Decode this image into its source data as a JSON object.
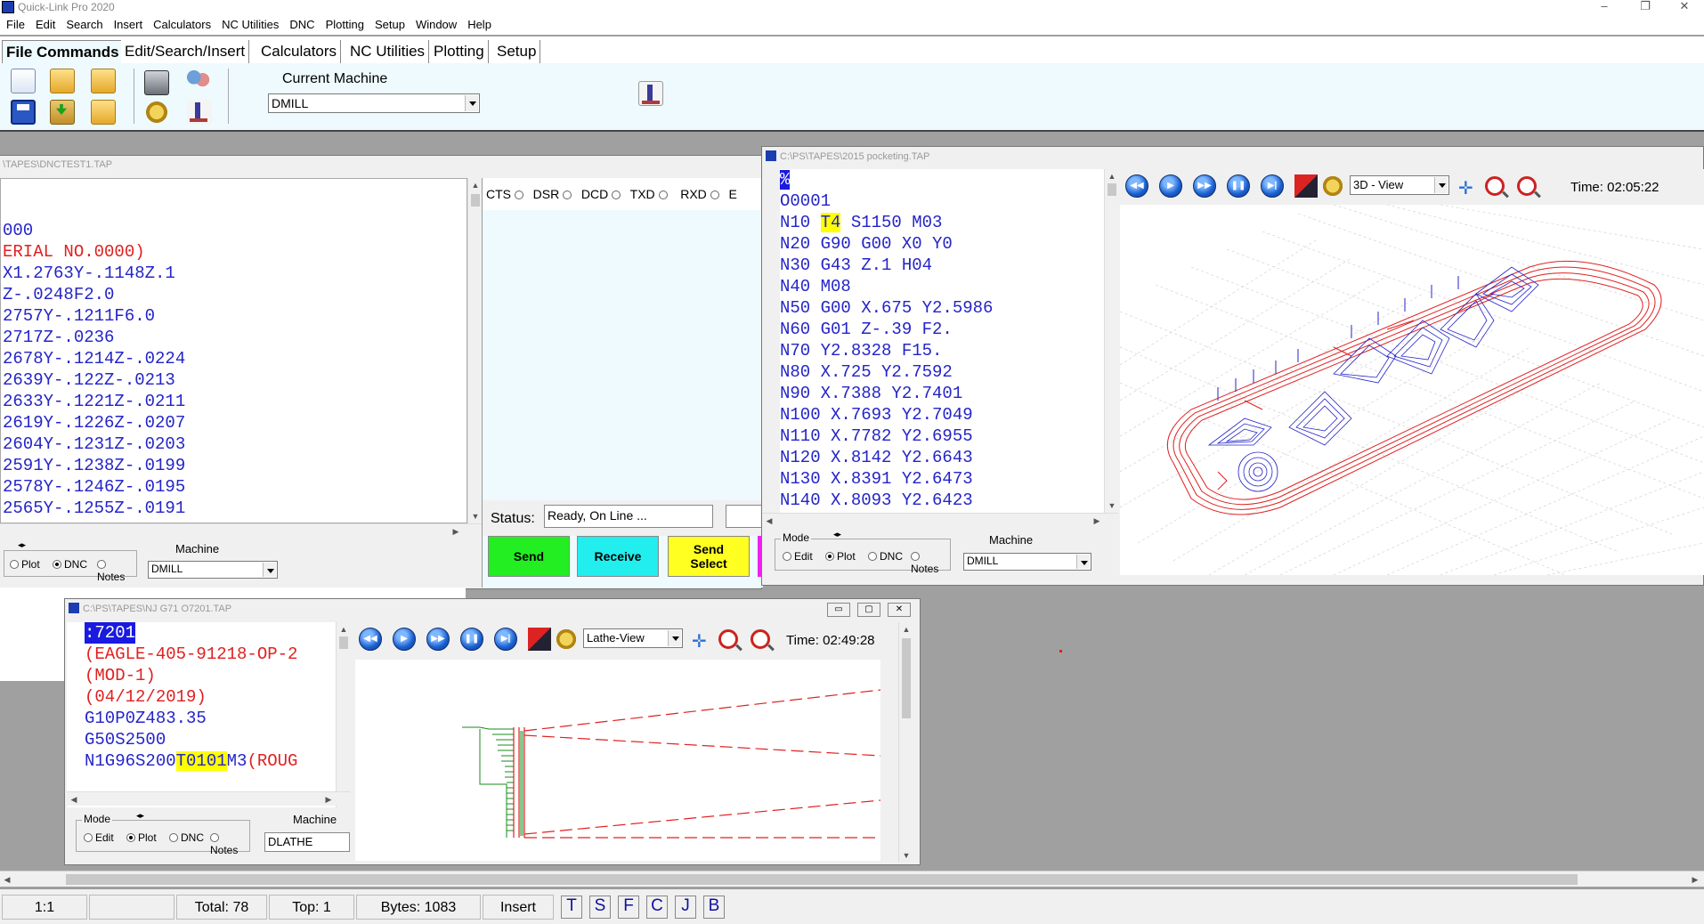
{
  "app": {
    "title": "Quick-Link Pro 2020"
  },
  "window_controls": {
    "minimize": "–",
    "restore": "❐",
    "close": "✕"
  },
  "menu": [
    "File",
    "Edit",
    "Search",
    "Insert",
    "Calculators",
    "NC Utilities",
    "DNC",
    "Plotting",
    "Setup",
    "Window",
    "Help"
  ],
  "ribbon_tabs": [
    "File Commands",
    "Edit/Search/Insert",
    "Calculators",
    "NC Utilities",
    "Plotting",
    "Setup"
  ],
  "ribbon": {
    "current_machine_label": "Current Machine",
    "current_machine_value": "DMILL"
  },
  "dnc_window": {
    "title": "\\TAPES\\DNCTEST1.TAP",
    "code": [
      {
        "t": "000",
        "c": "blue"
      },
      {
        "t": "ERIAL NO.0000)",
        "c": "red"
      },
      {
        "t": "X1.2763Y-.1148Z.1",
        "c": "blue"
      },
      {
        "t": "Z-.0248F2.0",
        "c": "blue"
      },
      {
        "t": "2757Y-.1211F6.0",
        "c": "blue"
      },
      {
        "t": "2717Z-.0236",
        "c": "blue"
      },
      {
        "t": "2678Y-.1214Z-.0224",
        "c": "blue"
      },
      {
        "t": "2639Y-.122Z-.0213",
        "c": "blue"
      },
      {
        "t": "2633Y-.1221Z-.0211",
        "c": "blue"
      },
      {
        "t": "2619Y-.1226Z-.0207",
        "c": "blue"
      },
      {
        "t": "2604Y-.1231Z-.0203",
        "c": "blue"
      },
      {
        "t": "2591Y-.1238Z-.0199",
        "c": "blue"
      },
      {
        "t": "2578Y-.1246Z-.0195",
        "c": "blue"
      },
      {
        "t": "2565Y-.1255Z-.0191",
        "c": "blue"
      }
    ],
    "signals": [
      "CTS",
      "DSR",
      "DCD",
      "TXD",
      "RXD",
      "E"
    ],
    "status_label": "Status:",
    "status_value": "Ready, On Line ...",
    "buttons": {
      "send": "Send",
      "receive": "Receive",
      "send_select": "Send\nSelect"
    },
    "modes": [
      "Plot",
      "DNC",
      "Notes"
    ],
    "machine_label": "Machine",
    "machine_value": "DMILL"
  },
  "mill_window": {
    "title": "C:\\PS\\TAPES\\2015 pocketing.TAP",
    "code": [
      "%",
      "O0001",
      "N10 T4 S1150 M03",
      "N20 G90 G00 X0 Y0",
      "N30 G43 Z.1 H04",
      "N40 M08",
      "N50 G00 X.675 Y2.5986",
      "N60 G01 Z-.39 F2.",
      "N70 Y2.8328 F15.",
      "N80 X.725 Y2.7592",
      "N90 X.7388 Y2.7401",
      "N100 X.7693 Y2.7049",
      "N110 X.7782 Y2.6955",
      "N120 X.8142 Y2.6643",
      "N130 X.8391 Y2.6473",
      "N140 X.8093 Y2.6423"
    ],
    "view": "3D - View",
    "time": "Time: 02:05:22",
    "modes": [
      "Edit",
      "Plot",
      "DNC",
      "Notes"
    ],
    "mode_label": "Mode",
    "machine_label": "Machine",
    "machine_value": "DMILL"
  },
  "lathe_window": {
    "title": "C:\\PS\\TAPES\\NJ G71 O7201.TAP",
    "code_line1": ":7201",
    "code_line2": "(EAGLE-405-91218-OP-2",
    "code_line3": "(MOD-1)",
    "code_line4": "(04/12/2019)",
    "code_line5": "G10P0Z483.35",
    "code_line6": "G50S2500",
    "code_line7_a": "N1G96S200",
    "code_line7_b": "T0101",
    "code_line7_c": "M3",
    "code_line7_d": "(ROUG",
    "view": "Lathe-View",
    "time": "Time: 02:49:28",
    "modes": [
      "Edit",
      "Plot",
      "DNC",
      "Notes"
    ],
    "mode_label": "Mode",
    "machine_label": "Machine",
    "machine_value": "DLATHE"
  },
  "statusbar": {
    "pos": "1:1",
    "total": "Total: 78",
    "top": "Top: 1",
    "bytes": "Bytes: 1083",
    "mode": "Insert",
    "letters": [
      "T",
      "S",
      "F",
      "C",
      "J",
      "B"
    ]
  }
}
